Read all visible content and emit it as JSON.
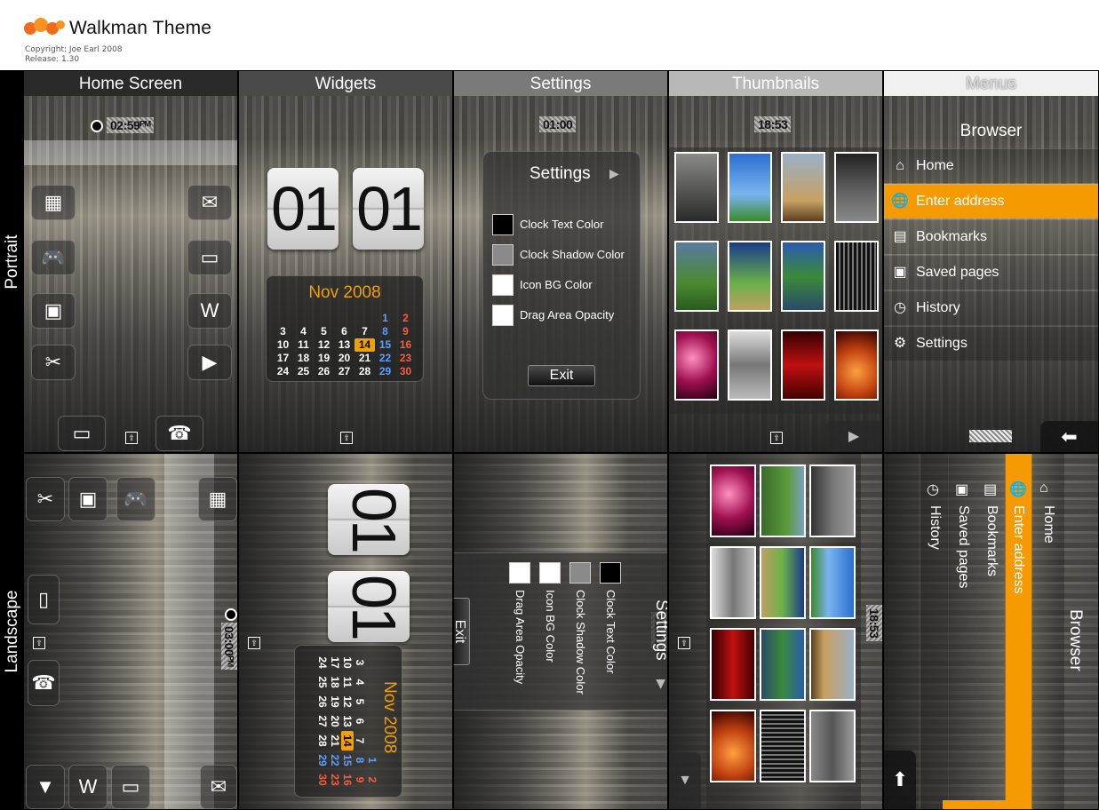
{
  "header": {
    "title": "Walkman Theme",
    "copyright": "Copyright: Joe Earl 2008",
    "release": "Release: 1.30"
  },
  "rows": {
    "portrait": "Portrait",
    "landscape": "Landscape"
  },
  "columns": [
    "Home Screen",
    "Widgets",
    "Settings",
    "Thumbnails",
    "Menus"
  ],
  "home": {
    "clock": "02:59ᴾᴹ",
    "clock_land": "03:00ᴾᴹ"
  },
  "widgets": {
    "hours": "01",
    "minutes": "01",
    "month": "Nov 2008",
    "calendar": [
      "",
      "",
      "",
      "",
      "",
      "1",
      "2",
      "3",
      "4",
      "5",
      "6",
      "7",
      "8",
      "9",
      "10",
      "11",
      "12",
      "13",
      "14",
      "15",
      "16",
      "17",
      "18",
      "19",
      "20",
      "21",
      "22",
      "23",
      "24",
      "25",
      "26",
      "27",
      "28",
      "29",
      "30"
    ],
    "today": "14"
  },
  "settings": {
    "clock": "01:00",
    "title": "Settings",
    "items": [
      "Clock Text Color",
      "Clock Shadow Color",
      "Icon BG Color",
      "Drag Area Opacity"
    ],
    "swatches": [
      "#000000",
      "#8a8a8a",
      "#ffffff",
      "#ffffff"
    ],
    "exit": "Exit"
  },
  "thumbs": {
    "clock": "18:53"
  },
  "menus": {
    "title": "Browser",
    "items": [
      {
        "label": "Home",
        "icon": "home-icon"
      },
      {
        "label": "Enter address",
        "icon": "globe-icon"
      },
      {
        "label": "Bookmarks",
        "icon": "bookmark-icon"
      },
      {
        "label": "Saved pages",
        "icon": "save-icon"
      },
      {
        "label": "History",
        "icon": "clock-icon"
      },
      {
        "label": "Settings",
        "icon": "gear-icon"
      }
    ],
    "selected": "Enter address"
  },
  "colors": {
    "accent": "#f59a00",
    "calendar_blue": "#5aa0ff",
    "calendar_red": "#ff5a3a"
  }
}
